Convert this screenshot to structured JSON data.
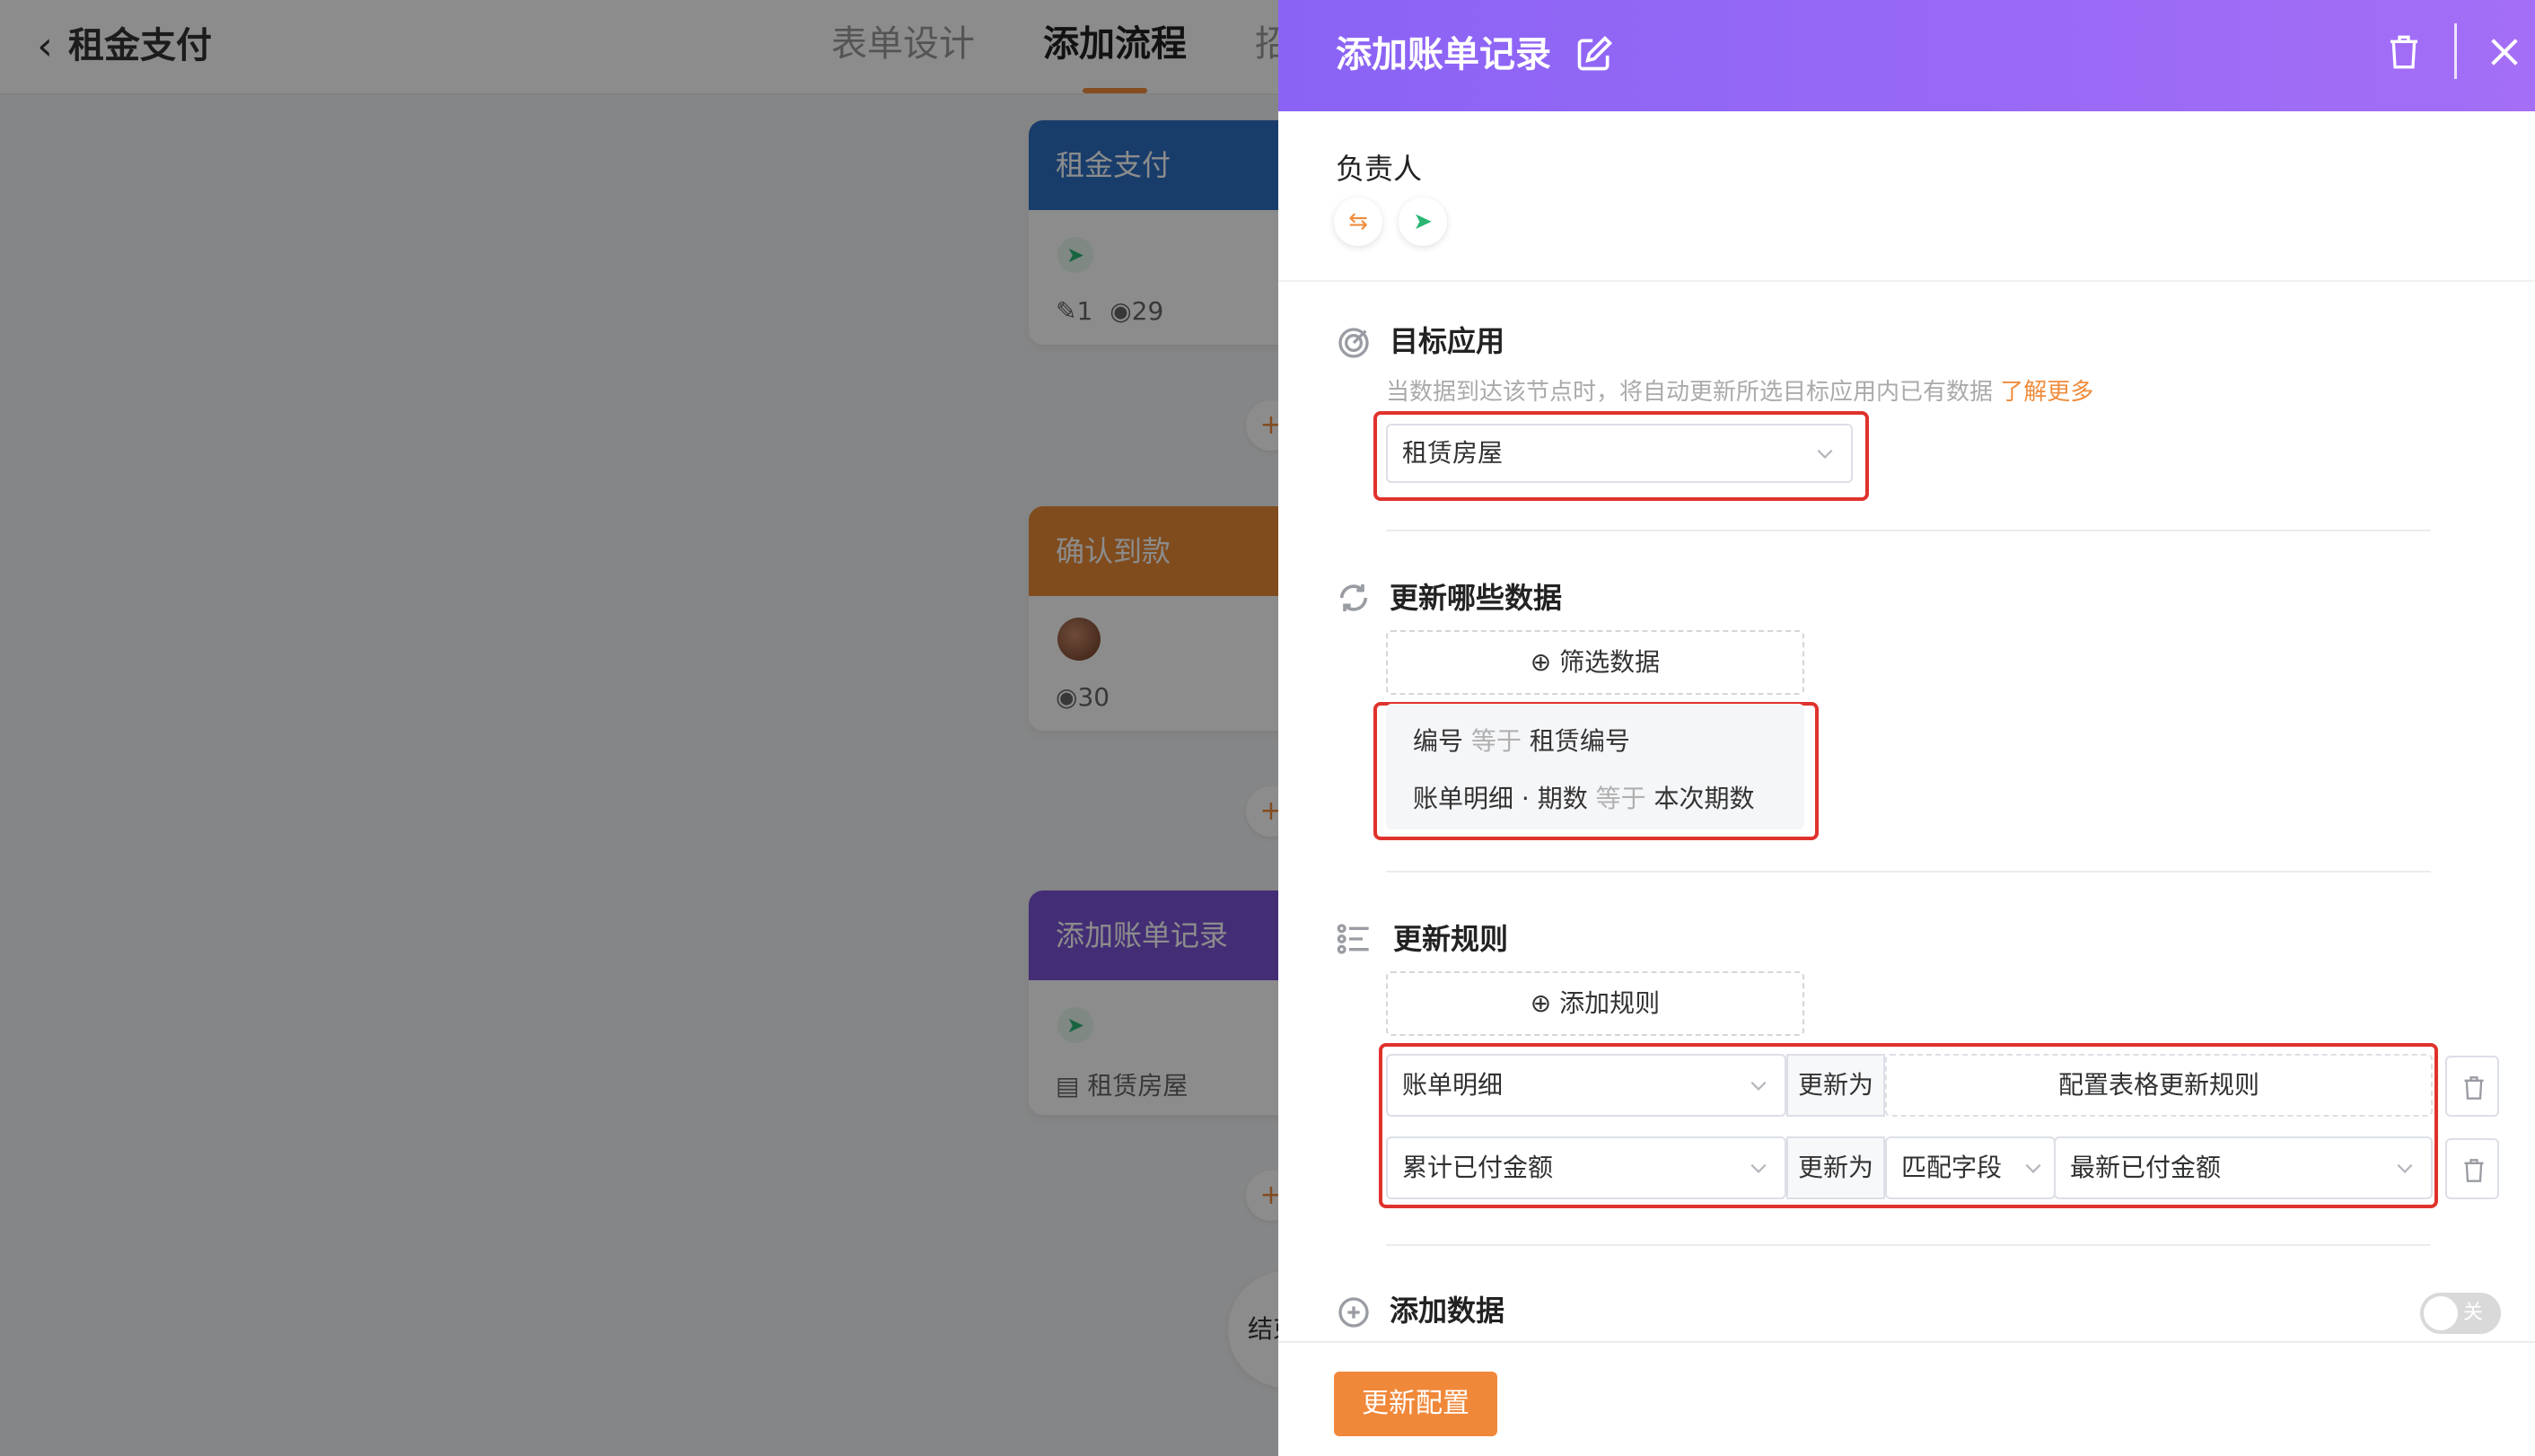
{
  "header": {
    "back_icon": "chevron-left-icon",
    "app_title": "租金支付",
    "tabs": [
      {
        "label": "表单设计"
      },
      {
        "label": "添加流程"
      },
      {
        "label": "招"
      }
    ],
    "active_tab": "添加流程",
    "accent": "#f08c3c"
  },
  "canvas": {
    "cards": [
      {
        "title": "租金支付",
        "color": "#2f6fc4",
        "icon": "send-icon",
        "meta_edit": "1",
        "meta_view": "29"
      },
      {
        "title": "确认到款",
        "color": "#e98a38",
        "icon": "avatar",
        "meta_view": "30"
      },
      {
        "title": "添加账单记录",
        "color": "#7a55d6",
        "icon": "send-icon",
        "meta_app": "租赁房屋"
      }
    ],
    "plus_label": "+",
    "end_label": "结束"
  },
  "panel": {
    "title": "添加账单记录",
    "gradient": [
      "#8a63f5",
      "#a46ef6"
    ],
    "owner_label": "负责人",
    "owner_icons": [
      "swap-icon",
      "send-icon"
    ],
    "target_app": {
      "title": "目标应用",
      "hint": "当数据到达该节点时，将自动更新所选目标应用内已有数据",
      "learn_more": "了解更多",
      "selected": "租赁房屋"
    },
    "update_data": {
      "title": "更新哪些数据",
      "filter_button": "筛选数据",
      "conditions": [
        {
          "field": "编号",
          "op": "等于",
          "value": "租赁编号"
        },
        {
          "field": "账单明细 · 期数",
          "op": "等于",
          "value": "本次期数"
        }
      ]
    },
    "rules": {
      "title": "更新规则",
      "add_button": "添加规则",
      "update_to": "更新为",
      "row1": {
        "field": "账单明细",
        "action": "配置表格更新规则"
      },
      "row2": {
        "field": "累计已付金额",
        "mode": "匹配字段",
        "value": "最新已付金额"
      }
    },
    "add_data": {
      "title": "添加数据",
      "toggle_label": "关",
      "toggle_on": false
    },
    "submit": "更新配置",
    "highlight_color": "#e0322c"
  }
}
